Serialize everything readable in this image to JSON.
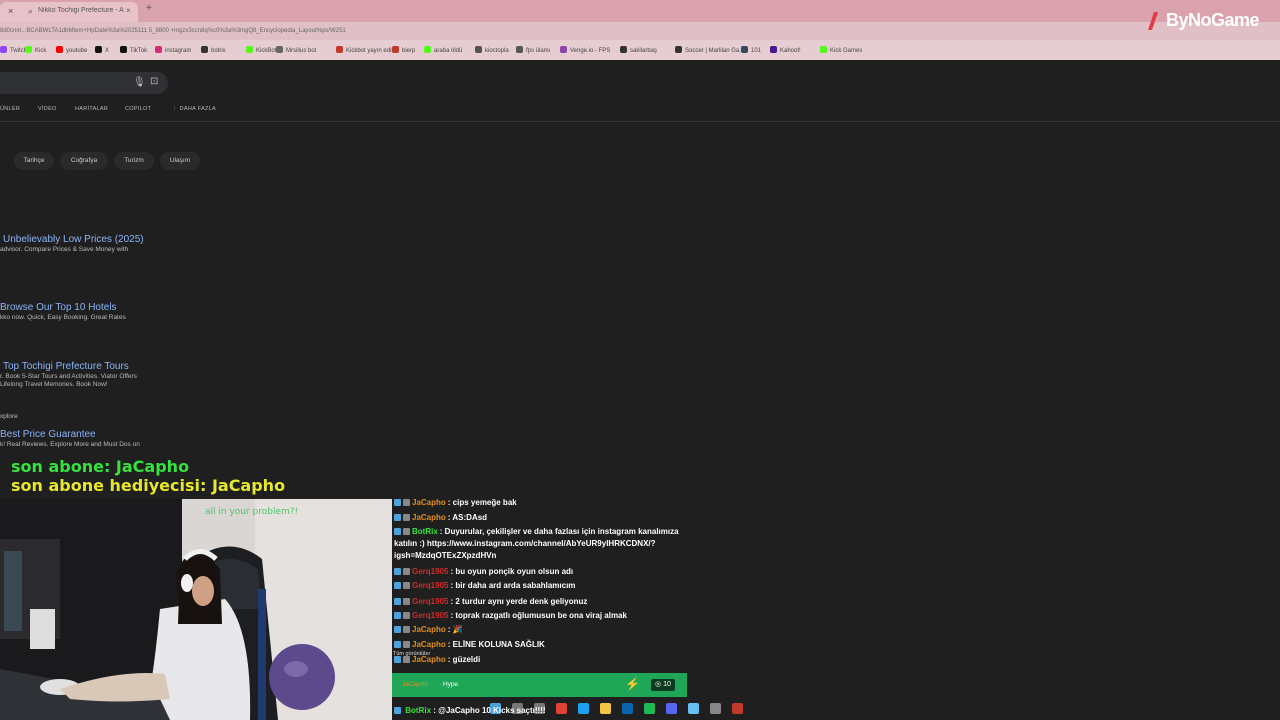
{
  "browser": {
    "tab_close": "×",
    "tab_title": "Nikko Tochigi Prefecture - Ara",
    "tab_close_2": "×",
    "new_tab": "+",
    "url": "8d0cnm...BCABWLTA1dbMtem+HpDate%3a%2025111 5_8800 +mgzx3ccn8q%c0%3a%3mgQ8_Encyclopedia_Layout%ps/W251",
    "bookmarks": [
      {
        "label": "Twitch",
        "color": "#9146ff"
      },
      {
        "label": "Kick",
        "color": "#53fc18"
      },
      {
        "label": "youtube",
        "color": "#ff0000"
      },
      {
        "label": "X",
        "color": "#111111"
      },
      {
        "label": "TikTok",
        "color": "#111111"
      },
      {
        "label": "instagram",
        "color": "#d62976"
      },
      {
        "label": "botrix",
        "color": "#333333"
      },
      {
        "label": "KickBot",
        "color": "#53fc18"
      },
      {
        "label": "Mrsilius bot",
        "color": "#666666"
      },
      {
        "label": "Kickbot yayın editi",
        "color": "#c0392b"
      },
      {
        "label": "bierp",
        "color": "#c0392b"
      },
      {
        "label": "araba öldü",
        "color": "#53fc18"
      },
      {
        "label": "kioctopla",
        "color": "#555555"
      },
      {
        "label": "fps ülamı",
        "color": "#555555"
      },
      {
        "label": "Venge.io - FPS",
        "color": "#8e44ad"
      },
      {
        "label": "sakilarbaş",
        "color": "#333333"
      },
      {
        "label": "Soccer | Marlilan Ga...",
        "color": "#333333"
      },
      {
        "label": "101",
        "color": "#34495e"
      },
      {
        "label": "Kahoot!",
        "color": "#46178f"
      },
      {
        "label": "Kick Games",
        "color": "#53fc18"
      }
    ]
  },
  "logo": {
    "text": "ByNoGame",
    "color": "#e63946"
  },
  "search": {
    "mic_icon": "microphone-icon",
    "lens_icon": "lens-icon"
  },
  "nav_tabs": [
    "ÜNLER",
    "VİDEO",
    "HARİTALAR",
    "COPILOT",
    "⋮ DAHA FAZLA"
  ],
  "chips": [
    "Tarihçe",
    "Coğrafya",
    "Turizm",
    "Ulaşım"
  ],
  "results": [
    {
      "title": "Unbelievably Low Prices (2025)",
      "desc": [
        "advisor. Compare Prices & Save Money with"
      ]
    },
    {
      "title": "Browse Our Top 10 Hotels",
      "desc": [
        "kko now. Quick, Easy Booking. Great Rates"
      ]
    },
    {
      "title": "Top Tochigi Prefecture Tours",
      "desc": [
        "r. Book 5-Star Tours and Activities. Viator Offers",
        "Lifelong Travel Memories. Book Now!"
      ]
    },
    {
      "title": "Best Price Guarantee",
      "desc": [
        "k! Real Reviews. Explore More and Must Dos on"
      ],
      "pre": "xplore"
    }
  ],
  "overlay": {
    "last_sub": "son abone: JaCapho",
    "last_gifter": "son abone hediyecisi: JaCapho",
    "sub_color": "#35e33d",
    "gifter_color": "#e8e82a"
  },
  "webcam": {
    "overlay_text": "all in your problem?!"
  },
  "chat": {
    "messages": [
      {
        "user": "JaCapho",
        "color": "#e38f1b",
        "text": ": cips yemeğe bak"
      },
      {
        "user": "JaCapho",
        "color": "#e38f1b",
        "text": ": AS:DAsd"
      },
      {
        "user": "BotRix",
        "color": "#35e33d",
        "text": ": Duyurular, çekilişler ve daha fazlası için instagram kanalımıza"
      },
      {
        "user": "",
        "color": "#ffffff",
        "text": "katılın :) https://www.instagram.com/channel/AbYeUR9yIHRKCDNX/?"
      },
      {
        "user": "",
        "color": "#ffffff",
        "text": "igsh=MzdqOTExZXpzdHVn"
      },
      {
        "user": "Gerq1905",
        "color": "#d12b2b",
        "text": ": bu oyun ponçik oyun olsun adı"
      },
      {
        "user": "Gerq1905",
        "color": "#d12b2b",
        "text": ": bir daha ard arda sabahlamıcım"
      },
      {
        "user": "Gerq1905",
        "color": "#d12b2b",
        "text": ": 2 turdur aynı yerde denk geliyonuz"
      },
      {
        "user": "Gerq1905",
        "color": "#d12b2b",
        "text": ": toprak razgatlı oğlumusun be ona viraj almak"
      },
      {
        "user": "JaCapho",
        "color": "#e38f1b",
        "text": ": 🎉"
      },
      {
        "user": "JaCapho",
        "color": "#e38f1b",
        "text": ": ELİNE KOLUNA SAĞLIK"
      },
      {
        "user": "JaCapho",
        "color": "#e38f1b",
        "text": ": güzeldi"
      }
    ],
    "viewers_label": "Tüm görüntüler",
    "hype": {
      "user": "JaCapho",
      "label": "· Hype",
      "count": "10",
      "icon": "lightning-icon"
    },
    "last": {
      "user": "BotRix",
      "text": ": @JaCapho 10 Kicks saçtı!!!!"
    }
  },
  "taskbar": [
    {
      "name": "start-icon",
      "color": "#4aa3df"
    },
    {
      "name": "search-icon",
      "color": "#777777"
    },
    {
      "name": "taskview-icon",
      "color": "#777777"
    },
    {
      "name": "chrome-icon",
      "color": "#e34133"
    },
    {
      "name": "edge-icon",
      "color": "#1da1f2"
    },
    {
      "name": "folder-icon",
      "color": "#f5c542"
    },
    {
      "name": "outlook-icon",
      "color": "#0a64ad"
    },
    {
      "name": "spotify-icon",
      "color": "#1db954"
    },
    {
      "name": "discord-icon",
      "color": "#5865f2"
    },
    {
      "name": "steam-icon",
      "color": "#66c0f4"
    },
    {
      "name": "settings-icon",
      "color": "#888888"
    },
    {
      "name": "obs-icon",
      "color": "#c0392b"
    }
  ]
}
